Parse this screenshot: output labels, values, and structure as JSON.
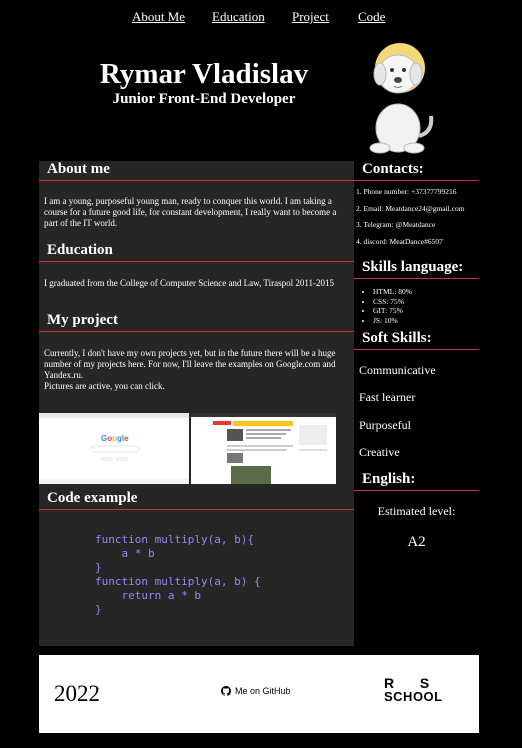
{
  "nav": {
    "about": "About Me",
    "education": "Education",
    "project": "Project",
    "code": "Code"
  },
  "header": {
    "name": "Rymar Vladislav",
    "role": "Junior Front-End Developer"
  },
  "about": {
    "title": "About me",
    "text": "I am a young, purposeful young man, ready to conquer this world. I am taking a course for a future good life, for constant development, I really want to become a part of the IT world."
  },
  "education": {
    "title": "Education",
    "text": "I graduated from the College of Computer Science and Law, Tiraspol 2011-2015"
  },
  "project": {
    "title": "My project",
    "text1": "Currently, I don't have my own projects yet, but in the future there will be a huge number of my projects here. For now, I'll leave the examples on Google.com and Yandex.ru.",
    "text2": "Pictures are active, you can click."
  },
  "code_example": {
    "title": "Code example",
    "line1": "function multiply(a, b){",
    "line2": "    a * b",
    "line3": "}",
    "line4": "function multiply(a, b) {",
    "line5": "    return a * b",
    "line6": "}"
  },
  "contacts": {
    "title": "Contacts:",
    "items": [
      "1. Phone number: +37377799216",
      "2. Email: Meatdance24@gmail.com",
      "3. Telegram: @Meatdance",
      "4. discord: MeatDance#6507"
    ]
  },
  "skills": {
    "title": "Skills language:",
    "items": [
      "HTML: 80%",
      "CSS: 75%",
      "GIT: 75%",
      "JS: 10%"
    ]
  },
  "soft_skills": {
    "title": "Soft Skills:",
    "items": [
      "Communicative",
      "Fast learner",
      "Purposeful",
      "Creative"
    ]
  },
  "english": {
    "title": "English:",
    "estimated": "Estimated level:",
    "level": "A2"
  },
  "footer": {
    "year": "2022",
    "github": "Me on GitHub",
    "rs_top": "R  S",
    "rs_bottom": "SCHOOL"
  },
  "colors": {
    "background": "#000000",
    "panel": "#262626",
    "accent_line": "#c0392b",
    "code": "#8c8cf0"
  }
}
